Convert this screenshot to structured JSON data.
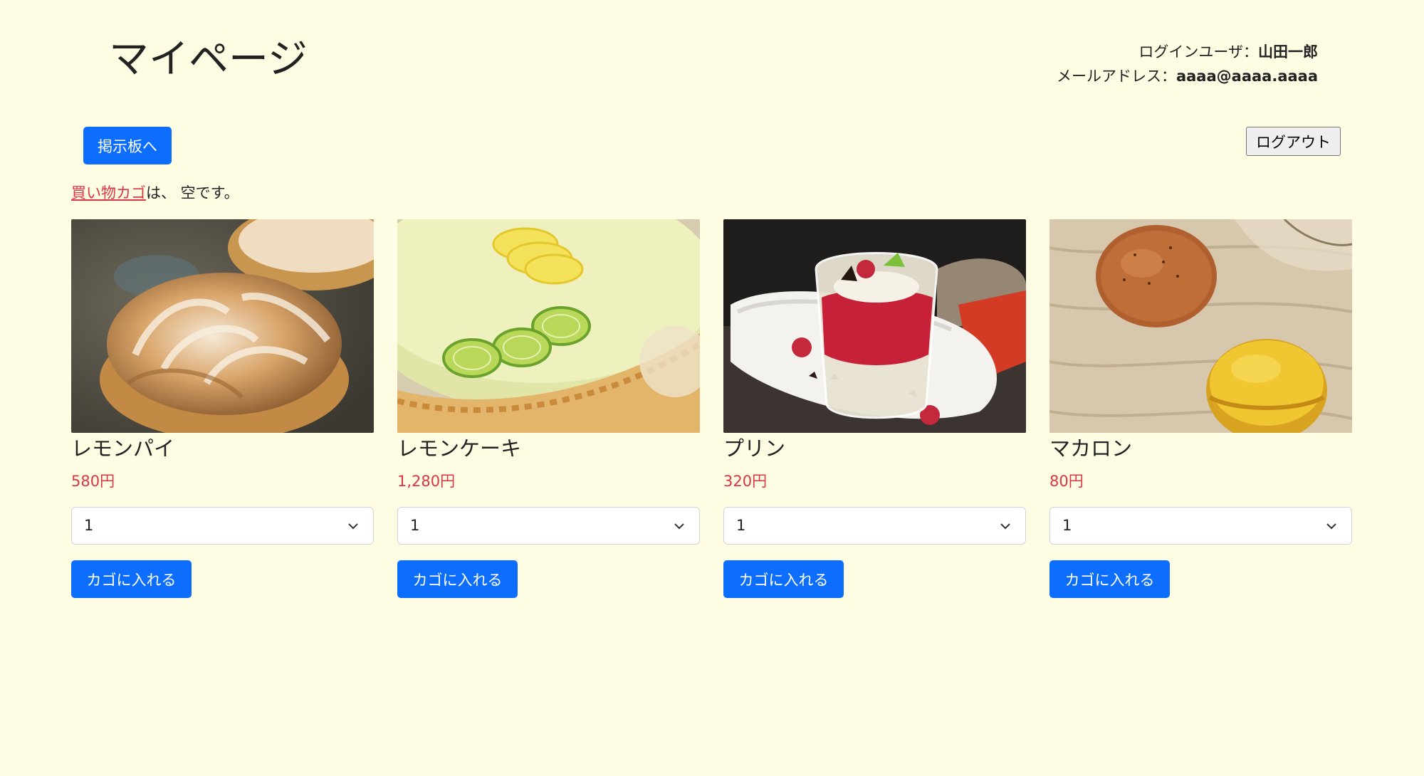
{
  "header": {
    "title": "マイページ",
    "login_user_label": "ログインユーザ：",
    "login_user_name": "山田一郎",
    "email_label": "メールアドレス：",
    "email_value": "aaaa@aaaa.aaaa"
  },
  "toolbar": {
    "board_label": "掲示板へ",
    "logout_label": "ログアウト"
  },
  "cart": {
    "link_text": "買い物カゴ",
    "status_text": "は、 空です。"
  },
  "products": [
    {
      "name": "レモンパイ",
      "price": "580円",
      "quantity": "1",
      "add_label": "カゴに入れる"
    },
    {
      "name": "レモンケーキ",
      "price": "1,280円",
      "quantity": "1",
      "add_label": "カゴに入れる"
    },
    {
      "name": "プリン",
      "price": "320円",
      "quantity": "1",
      "add_label": "カゴに入れる"
    },
    {
      "name": "マカロン",
      "price": "80円",
      "quantity": "1",
      "add_label": "カゴに入れる"
    }
  ],
  "colors": {
    "background": "#fefde4",
    "primary": "#0d6efd",
    "price": "#dc3545"
  }
}
